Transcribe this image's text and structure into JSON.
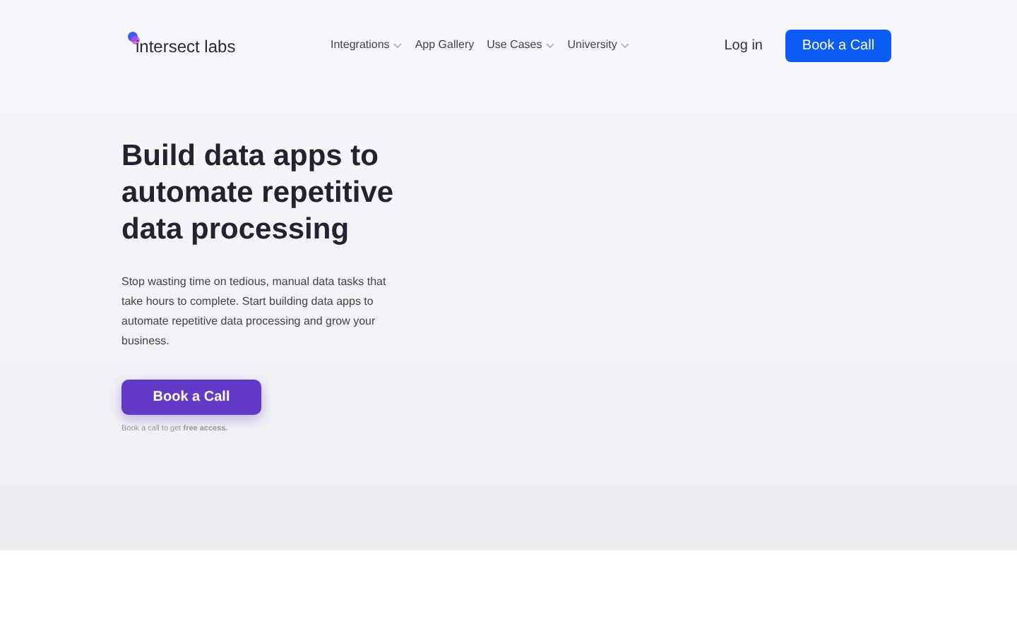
{
  "logo": {
    "text": "intersect labs"
  },
  "nav": [
    {
      "label": "Integrations",
      "kind": "dropdown"
    },
    {
      "label": "App Gallery",
      "kind": "link"
    },
    {
      "label": "Use Cases",
      "kind": "dropdown"
    },
    {
      "label": "University",
      "kind": "dropdown"
    }
  ],
  "login": "Log in",
  "header_button": "Book a Call",
  "hero": {
    "title": "Build data apps to automate repetitive data processing",
    "description": "Stop wasting time on tedious, manual data tasks that take hours to complete. Start building data apps to automate repetitive data processing and grow your business.",
    "button": "Book a Call",
    "note": "Book a call to get **free access.**"
  }
}
